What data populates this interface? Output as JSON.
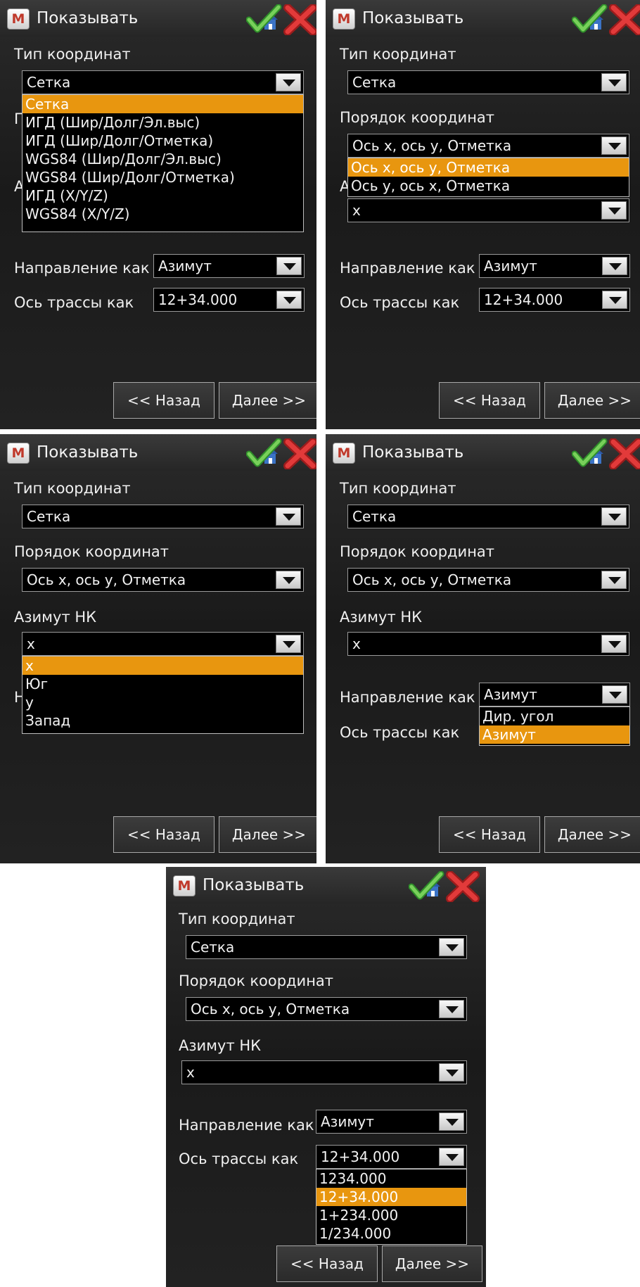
{
  "window": {
    "title": "Показывать",
    "app_icon_letter": "M"
  },
  "labels": {
    "coord_type": "Тип координат",
    "coord_order": "Порядок координат",
    "azimuth_nk": "Азимут НК",
    "direction_as": "Направление как",
    "route_axis_as": "Ось трассы как"
  },
  "values": {
    "coord_type": "Сетка",
    "coord_order": "Ось x, ось y, Отметка",
    "azimuth_nk": "x",
    "direction_as": "Азимут",
    "route_axis_as": "12+34.000"
  },
  "options": {
    "coord_type": [
      "Сетка",
      "ИГД (Шир/Долг/Эл.выс)",
      "ИГД (Шир/Долг/Отметка)",
      "WGS84 (Шир/Долг/Эл.выс)",
      "WGS84 (Шир/Долг/Отметка)",
      "ИГД (X/Y/Z)",
      "WGS84 (X/Y/Z)"
    ],
    "coord_order": [
      "Ось x, ось y, Отметка",
      "Ось y, ось x, Отметка"
    ],
    "azimuth_nk": [
      "x",
      "Юг",
      "y",
      "Запад"
    ],
    "direction_as": [
      "Дир. угол",
      "Азимут"
    ],
    "route_axis_as": [
      "1234.000",
      "12+34.000",
      "1+234.000",
      "1/234.000"
    ]
  },
  "peek_letters": {
    "order_label_first": "П",
    "azimuth_label_first": "А",
    "direction_label_first": "Н"
  },
  "buttons": {
    "back": "<< Назад",
    "next": "Далее >>"
  },
  "icons": {
    "ok": "green-checkmark-home-icon",
    "cancel": "red-x-icon"
  },
  "colors": {
    "selection": "#e8960f",
    "background": "#1e1e1e",
    "text": "#f2f2f2"
  }
}
